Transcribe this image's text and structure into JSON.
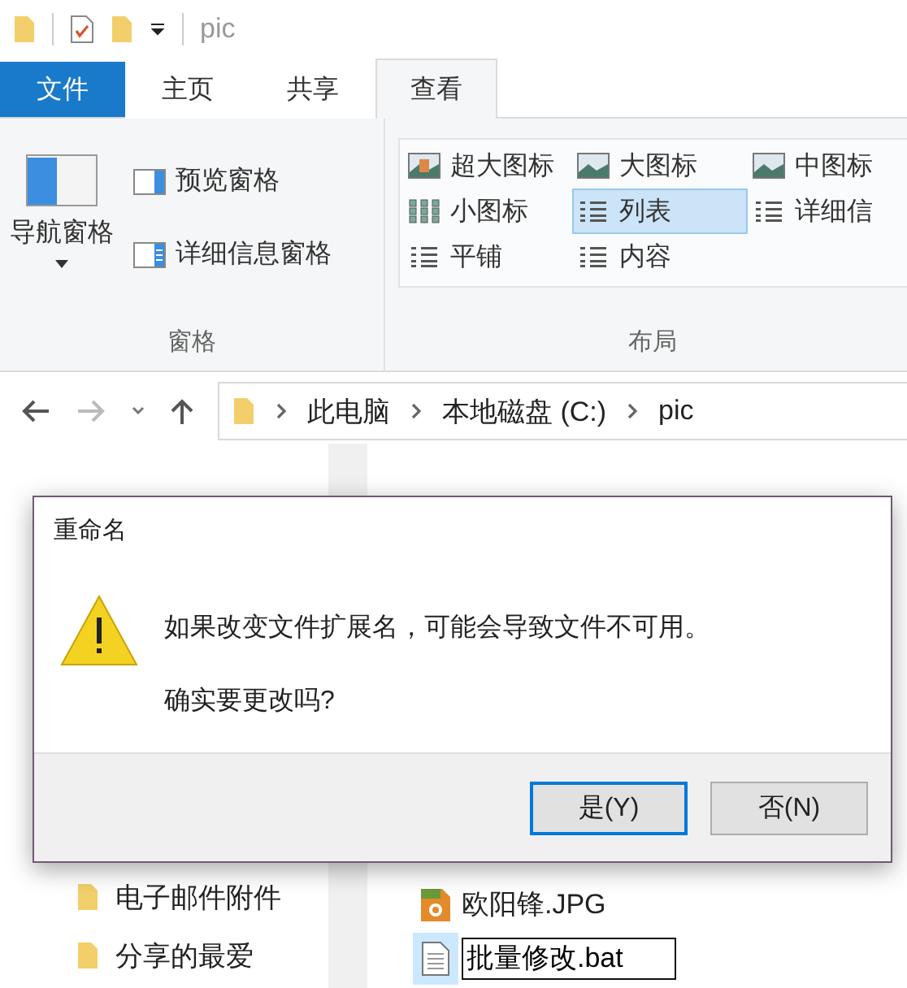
{
  "title_bar": {
    "title": "pic"
  },
  "tabs": [
    {
      "label": "文件",
      "kind": "file",
      "selected": false
    },
    {
      "label": "主页",
      "kind": "tab",
      "selected": false
    },
    {
      "label": "共享",
      "kind": "tab",
      "selected": false
    },
    {
      "label": "查看",
      "kind": "tab",
      "selected": true
    }
  ],
  "ribbon": {
    "panes_group": {
      "label": "窗格",
      "nav_pane": "导航窗格",
      "buttons": [
        "预览窗格",
        "详细信息窗格"
      ]
    },
    "layout_group": {
      "label": "布局",
      "items": [
        {
          "label": "超大图标",
          "selected": false
        },
        {
          "label": "大图标",
          "selected": false
        },
        {
          "label": "中图标",
          "selected": false
        },
        {
          "label": "小图标",
          "selected": false
        },
        {
          "label": "列表",
          "selected": true
        },
        {
          "label": "详细信",
          "selected": false
        },
        {
          "label": "平铺",
          "selected": false
        },
        {
          "label": "内容",
          "selected": false
        }
      ]
    }
  },
  "address_bar": {
    "crumbs": [
      "此电脑",
      "本地磁盘 (C:)",
      "pic"
    ]
  },
  "nav_pane": {
    "items": [
      "电子邮件附件",
      "分享的最爱"
    ]
  },
  "files": [
    {
      "name": "欧阳锋.JPG",
      "kind": "jpg",
      "selected": false,
      "editing": false
    },
    {
      "name": "批量修改.bat",
      "kind": "bat",
      "selected": true,
      "editing": true
    }
  ],
  "dialog": {
    "title": "重命名",
    "message": "如果改变文件扩展名，可能会导致文件不可用。",
    "question": "确实要更改吗?",
    "buttons": [
      {
        "label": "是(Y)",
        "default": true
      },
      {
        "label": "否(N)",
        "default": false
      }
    ]
  }
}
